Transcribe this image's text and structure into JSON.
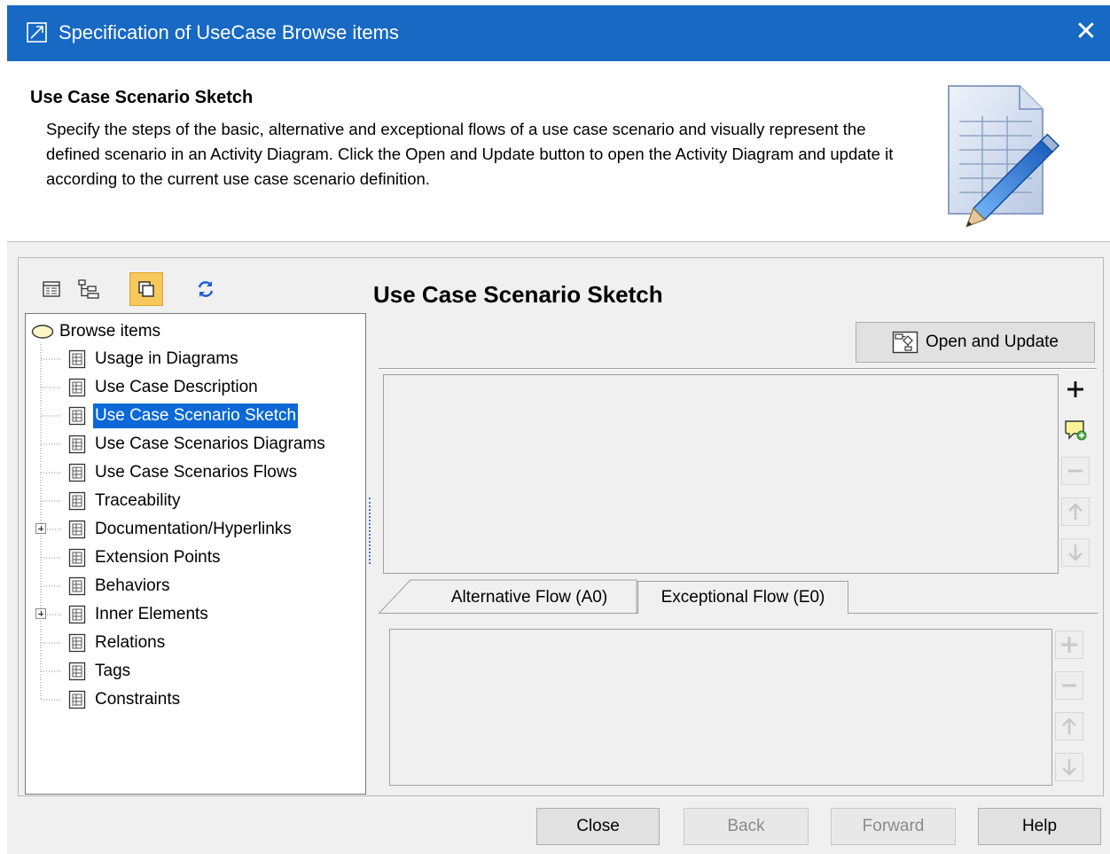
{
  "window": {
    "title": "Specification of UseCase Browse items",
    "close_label": "✕"
  },
  "header": {
    "title": "Use Case Scenario Sketch",
    "description": "Specify the steps of the basic, alternative and exceptional flows of a use case scenario and visually represent the defined scenario in an Activity Diagram. Click the Open and Update button to open the Activity Diagram and update it according to the current use case scenario definition.",
    "art_icon": "document-pencil-icon"
  },
  "toolbar": {
    "buttons": [
      {
        "name": "properties-view-icon",
        "active": false
      },
      {
        "name": "tree-view-icon",
        "active": false
      },
      {
        "name": "compact-view-icon",
        "active": true
      },
      {
        "name": "refresh-icon",
        "active": false
      }
    ]
  },
  "panel": {
    "heading": "Use Case Scenario Sketch",
    "open_update_label": "Open and Update"
  },
  "tree": {
    "root": "Browse items",
    "items": [
      {
        "label": "Usage in Diagrams",
        "expandable": false,
        "selected": false
      },
      {
        "label": "Use Case Description",
        "expandable": false,
        "selected": false
      },
      {
        "label": "Use Case Scenario Sketch",
        "expandable": false,
        "selected": true
      },
      {
        "label": "Use Case Scenarios Diagrams",
        "expandable": false,
        "selected": false
      },
      {
        "label": "Use Case Scenarios Flows",
        "expandable": false,
        "selected": false
      },
      {
        "label": "Traceability",
        "expandable": false,
        "selected": false
      },
      {
        "label": "Documentation/Hyperlinks",
        "expandable": true,
        "selected": false
      },
      {
        "label": "Extension Points",
        "expandable": false,
        "selected": false
      },
      {
        "label": "Behaviors",
        "expandable": false,
        "selected": false
      },
      {
        "label": "Inner Elements",
        "expandable": true,
        "selected": false
      },
      {
        "label": "Relations",
        "expandable": false,
        "selected": false
      },
      {
        "label": "Tags",
        "expandable": false,
        "selected": false
      },
      {
        "label": "Constraints",
        "expandable": false,
        "selected": false
      }
    ]
  },
  "tabs": [
    {
      "label": "Alternative Flow (A0)",
      "active": true
    },
    {
      "label": "Exceptional Flow (E0)",
      "active": false
    }
  ],
  "footer": {
    "close": "Close",
    "back": "Back",
    "forward": "Forward",
    "help": "Help",
    "back_enabled": false,
    "forward_enabled": false
  },
  "colors": {
    "titlebar": "#1769c4",
    "selection": "#0b68d6",
    "active_toolbar": "#f7c95a"
  }
}
